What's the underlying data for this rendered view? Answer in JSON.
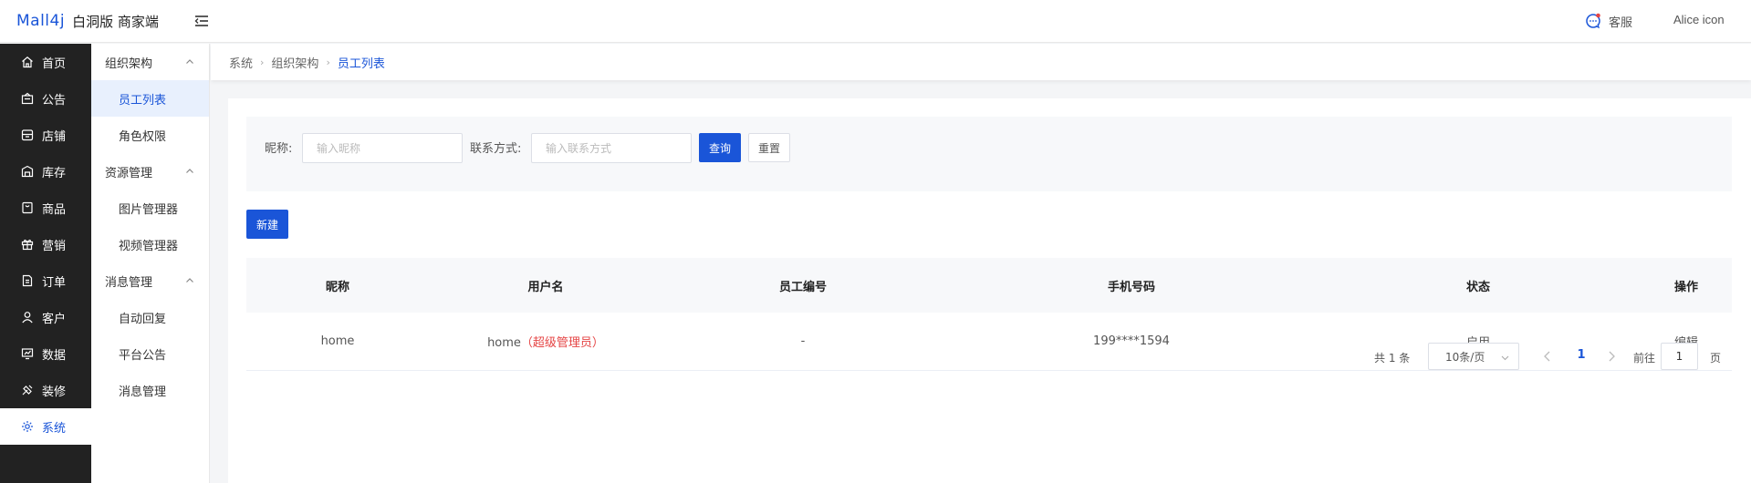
{
  "header": {
    "logo_mark": "Mall4j",
    "logo_text": "白洞版 商家端",
    "service_label": "客服",
    "user_label": "Alice icon"
  },
  "sidebar": {
    "items": [
      {
        "label": "首页",
        "icon": "home-icon"
      },
      {
        "label": "公告",
        "icon": "announcement-icon"
      },
      {
        "label": "店铺",
        "icon": "shop-icon"
      },
      {
        "label": "库存",
        "icon": "inventory-icon"
      },
      {
        "label": "商品",
        "icon": "product-icon"
      },
      {
        "label": "营销",
        "icon": "gift-icon"
      },
      {
        "label": "订单",
        "icon": "order-icon"
      },
      {
        "label": "客户",
        "icon": "user-icon"
      },
      {
        "label": "数据",
        "icon": "data-icon"
      },
      {
        "label": "装修",
        "icon": "decorate-icon"
      },
      {
        "label": "系统",
        "icon": "gear-icon"
      }
    ],
    "active_index": 10
  },
  "submenu": {
    "groups": [
      {
        "label": "组织架构",
        "items": [
          "员工列表",
          "角色权限"
        ]
      },
      {
        "label": "资源管理",
        "items": [
          "图片管理器",
          "视频管理器"
        ]
      },
      {
        "label": "消息管理",
        "items": [
          "自动回复",
          "平台公告",
          "消息管理"
        ]
      }
    ],
    "active_item": "员工列表"
  },
  "breadcrumb": [
    "系统",
    "组织架构",
    "员工列表"
  ],
  "search": {
    "nickname_label": "昵称:",
    "nickname_placeholder": "输入昵称",
    "contact_label": "联系方式:",
    "contact_placeholder": "输入联系方式",
    "query_button": "查询",
    "reset_button": "重置"
  },
  "new_button": "新建",
  "table": {
    "headers": [
      "昵称",
      "用户名",
      "员工编号",
      "手机号码",
      "状态",
      "操作"
    ],
    "rows": [
      {
        "nickname": "home",
        "username": "home",
        "username_tag": "（超级管理员）",
        "employee_no": "-",
        "phone": "199****1594",
        "status": "启用",
        "action": "编辑"
      }
    ]
  },
  "pagination": {
    "total": "共 1 条",
    "page_size": "10条/页",
    "current_page": "1",
    "goto_label": "前往",
    "goto_value": "1",
    "page_suffix": "页"
  },
  "colors": {
    "primary": "#1a55d8",
    "sidebar_bg": "#222222",
    "danger": "#e54545"
  }
}
